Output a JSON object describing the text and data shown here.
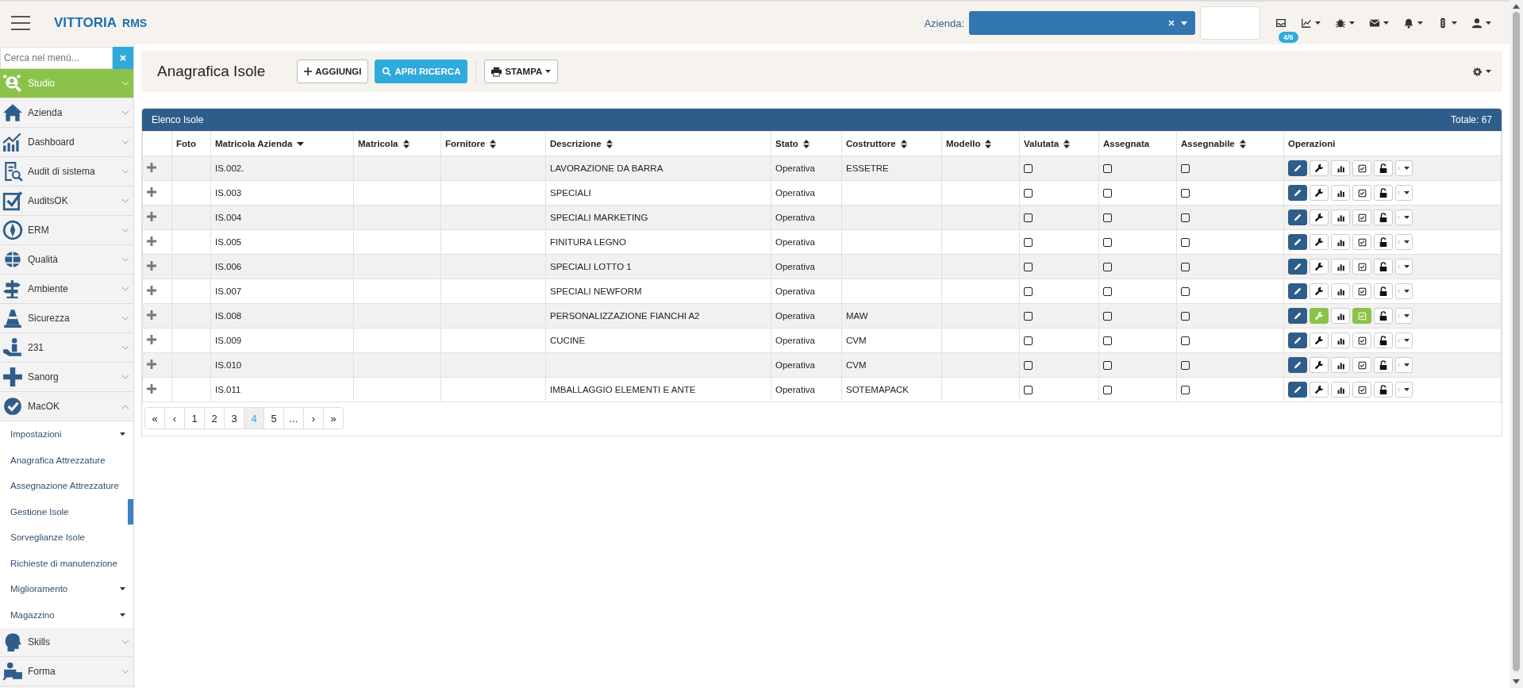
{
  "topbar": {
    "brand": "VITTORIA",
    "brand_suffix": "RMS",
    "company_label": "Azienda:",
    "badge": "4/6"
  },
  "sidebar": {
    "search_placeholder": "Cerca nel menù...",
    "items": [
      {
        "label": "Studio",
        "selected": true,
        "expanded": false
      },
      {
        "label": "Azienda",
        "selected": false,
        "expanded": false
      },
      {
        "label": "Dashboard",
        "selected": false,
        "expanded": false
      },
      {
        "label": "Audit di sistema",
        "selected": false,
        "expanded": false
      },
      {
        "label": "AuditsOK",
        "selected": false,
        "expanded": false
      },
      {
        "label": "ERM",
        "selected": false,
        "expanded": false
      },
      {
        "label": "Qualità",
        "selected": false,
        "expanded": false
      },
      {
        "label": "Ambiente",
        "selected": false,
        "expanded": false
      },
      {
        "label": "Sicurezza",
        "selected": false,
        "expanded": false
      },
      {
        "label": "231",
        "selected": false,
        "expanded": false
      },
      {
        "label": "Sanorg",
        "selected": false,
        "expanded": false
      },
      {
        "label": "MacOK",
        "selected": false,
        "expanded": true,
        "children": [
          {
            "label": "Impostazioni",
            "kind": "group",
            "selected": false
          },
          {
            "label": "Anagrafica Attrezzature",
            "kind": "link",
            "selected": false
          },
          {
            "label": "Assegnazione Attrezzature",
            "kind": "link",
            "selected": false
          },
          {
            "label": "Gestione Isole",
            "kind": "link",
            "selected": true
          },
          {
            "label": "Sorveglianze Isole",
            "kind": "link",
            "selected": false
          },
          {
            "label": "Richieste di manutenzione",
            "kind": "link",
            "selected": false
          },
          {
            "label": "Miglioramento",
            "kind": "group",
            "selected": false
          },
          {
            "label": "Magazzino",
            "kind": "group",
            "selected": false
          }
        ]
      },
      {
        "label": "Skills",
        "selected": false,
        "expanded": false
      },
      {
        "label": "Forma",
        "selected": false,
        "expanded": false
      }
    ]
  },
  "page": {
    "title": "Anagrafica Isole",
    "actions": [
      {
        "label": "AGGIUNGI",
        "kind": "add"
      },
      {
        "label": "APRI RICERCA",
        "kind": "search"
      },
      {
        "label": "STAMPA",
        "kind": "print"
      }
    ]
  },
  "table": {
    "title": "Elenco Isole",
    "total": "Totale: 67",
    "columns": [
      {
        "label": "Foto",
        "sortable": false
      },
      {
        "label": "Matricola Azienda",
        "sortable": true,
        "sorted_desc": true
      },
      {
        "label": "Matricola",
        "sortable": true,
        "sorted_desc": false
      },
      {
        "label": "Fornitore",
        "sortable": true,
        "sorted_desc": false
      },
      {
        "label": "Descrizione",
        "sortable": true,
        "sorted_desc": false
      },
      {
        "label": "Stato",
        "sortable": true,
        "sorted_desc": false
      },
      {
        "label": "Costruttore",
        "sortable": true,
        "sorted_desc": false
      },
      {
        "label": "Modello",
        "sortable": true,
        "sorted_desc": false
      },
      {
        "label": "Valutata",
        "sortable": true,
        "sorted_desc": false
      },
      {
        "label": "Assegnata",
        "sortable": false
      },
      {
        "label": "Assegnabile",
        "sortable": true,
        "sorted_desc": false
      },
      {
        "label": "Operazioni",
        "sortable": false
      }
    ],
    "rows": [
      {
        "code": "IS.002.",
        "description": "LAVORAZIONE DA BARRA",
        "status": "Operativa",
        "manufacturer": "ESSETRE",
        "valutata": false,
        "assegnata": false,
        "assegnabile": false,
        "maintenance_highlight": false
      },
      {
        "code": "IS.003",
        "description": "SPECIALI",
        "status": "Operativa",
        "valutata": false,
        "assegnata": false,
        "assegnabile": false,
        "maintenance_highlight": false
      },
      {
        "code": "IS.004",
        "description": "SPECIALI MARKETING",
        "status": "Operativa",
        "valutata": false,
        "assegnata": false,
        "assegnabile": false,
        "maintenance_highlight": false
      },
      {
        "code": "IS.005",
        "description": "FINITURA LEGNO",
        "status": "Operativa",
        "valutata": false,
        "assegnata": false,
        "assegnabile": false,
        "maintenance_highlight": false
      },
      {
        "code": "IS.006",
        "description": "SPECIALI LOTTO 1",
        "status": "Operativa",
        "valutata": false,
        "assegnata": false,
        "assegnabile": false,
        "maintenance_highlight": false
      },
      {
        "code": "IS.007",
        "description": "SPECIALI NEWFORM",
        "status": "Operativa",
        "valutata": false,
        "assegnata": false,
        "assegnabile": false,
        "maintenance_highlight": false
      },
      {
        "code": "IS.008",
        "description": "PERSONALIZZAZIONE FIANCHI A2",
        "status": "Operativa",
        "manufacturer": "MAW",
        "valutata": false,
        "assegnata": false,
        "assegnabile": false,
        "maintenance_highlight": true
      },
      {
        "code": "IS.009",
        "description": "CUCINE",
        "status": "Operativa",
        "manufacturer": "CVM",
        "valutata": false,
        "assegnata": false,
        "assegnabile": false,
        "maintenance_highlight": false
      },
      {
        "code": "IS.010",
        "status": "Operativa",
        "manufacturer": "CVM",
        "valutata": false,
        "assegnata": false,
        "assegnabile": false,
        "maintenance_highlight": false
      },
      {
        "code": "IS.011",
        "description": "IMBALLAGGIO ELEMENTI E ANTE",
        "status": "Operativa",
        "manufacturer": "SOTEMAPACK",
        "valutata": false,
        "assegnata": false,
        "assegnabile": false,
        "maintenance_highlight": false
      }
    ],
    "pagination": [
      {
        "label": "«",
        "selected": false
      },
      {
        "label": "‹",
        "selected": false
      },
      {
        "label": "1",
        "selected": false
      },
      {
        "label": "2",
        "selected": false
      },
      {
        "label": "3",
        "selected": false
      },
      {
        "label": "4",
        "selected": true
      },
      {
        "label": "5",
        "selected": false
      },
      {
        "label": "...",
        "selected": false
      },
      {
        "label": "›",
        "selected": false
      },
      {
        "label": "»",
        "selected": false
      }
    ]
  }
}
